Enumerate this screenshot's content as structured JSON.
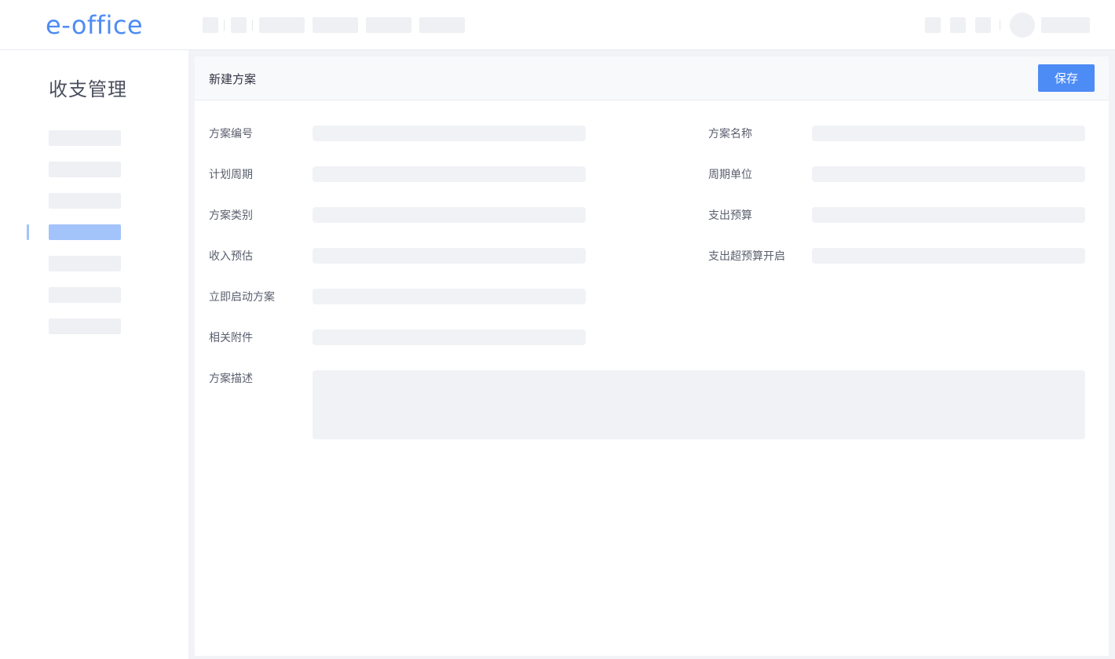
{
  "header": {
    "logo_text": "e-office",
    "logo_color": "#4d8cf5"
  },
  "sidebar": {
    "title": "收支管理",
    "active_index": 3,
    "active_color": "#a3c3fb",
    "item_count": 7
  },
  "panel": {
    "title": "新建方案",
    "save_label": "保存",
    "save_color": "#4d8cf5"
  },
  "form": {
    "left": [
      {
        "label": "方案编号",
        "value": ""
      },
      {
        "label": "计划周期",
        "value": ""
      },
      {
        "label": "方案类别",
        "value": ""
      },
      {
        "label": "收入预估",
        "value": ""
      },
      {
        "label": "立即启动方案",
        "value": ""
      },
      {
        "label": "相关附件",
        "value": ""
      }
    ],
    "right": [
      {
        "label": "方案名称",
        "value": ""
      },
      {
        "label": "周期单位",
        "value": ""
      },
      {
        "label": "支出预算",
        "value": ""
      },
      {
        "label": "支出超预算开启",
        "value": ""
      }
    ],
    "description": {
      "label": "方案描述",
      "value": ""
    }
  }
}
